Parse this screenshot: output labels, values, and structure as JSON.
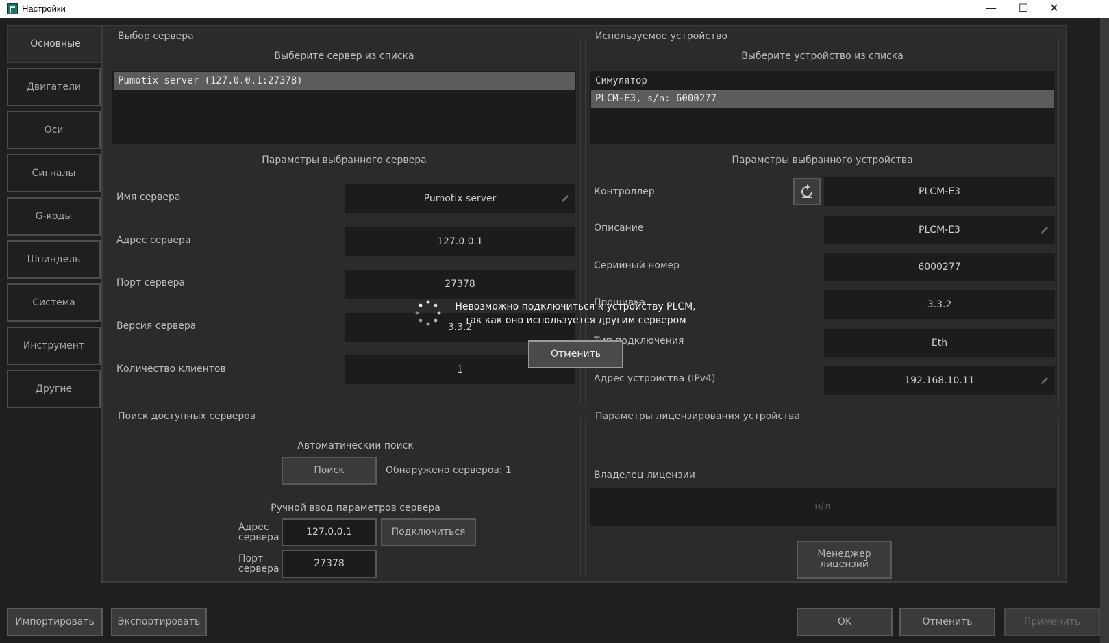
{
  "window": {
    "title": "Настройки",
    "minimize": "—",
    "maximize": "☐",
    "close": "✕"
  },
  "tabs": [
    "Основные",
    "Двигатели",
    "Оси",
    "Сигналы",
    "G-коды",
    "Шпиндель",
    "Система",
    "Инструмент",
    "Другие"
  ],
  "server": {
    "group_title": "Выбор сервера",
    "list_caption": "Выберите сервер из списка",
    "list": [
      "Pumotix server (127.0.0.1:27378)"
    ],
    "params_caption": "Параметры выбранного сервера",
    "name_label": "Имя сервера",
    "name_value": "Pumotix server",
    "address_label": "Адрес сервера",
    "address_value": "127.0.0.1",
    "port_label": "Порт сервера",
    "port_value": "27378",
    "version_label": "Версия сервера",
    "version_value": "3.3.2",
    "clients_label": "Количество клиентов",
    "clients_value": "1"
  },
  "device": {
    "group_title": "Используемое устройство",
    "list_caption": "Выберите устройство из списка",
    "list": [
      "Симулятор",
      "PLCM-E3, s/n: 6000277"
    ],
    "params_caption": "Параметры выбранного устройства",
    "controller_label": "Контроллер",
    "controller_value": "PLCM-E3",
    "description_label": "Описание",
    "description_value": "PLCM-E3",
    "serial_label": "Серийный номер",
    "serial_value": "6000277",
    "firmware_label": "Прошивка",
    "firmware_value": "3.3.2",
    "conn_label": "Тип подключения",
    "conn_value": "Eth",
    "ip_label": "Адрес устройства (IPv4)",
    "ip_value": "192.168.10.11"
  },
  "search": {
    "group_title": "Поиск доступных серверов",
    "auto_caption": "Автоматический поиск",
    "search_button": "Поиск",
    "found_text": "Обнаружено серверов: 1",
    "manual_caption": "Ручной ввод параметров сервера",
    "addr_label_1": "Адрес",
    "addr_label_2": "сервера",
    "addr_value": "127.0.0.1",
    "port_label_1": "Порт",
    "port_label_2": "сервера",
    "port_value": "27378",
    "connect_button": "Подключиться"
  },
  "license": {
    "group_title": "Параметры лицензирования устройства",
    "owner_label": "Владелец лицензии",
    "owner_value": "н/д",
    "manager_button_1": "Менеджер",
    "manager_button_2": "лицензий"
  },
  "overlay": {
    "message_line1": "Невозможно подключиться к устройству PLCM,",
    "message_line2": "так как оно используется другим сервером",
    "cancel_button": "Отменить"
  },
  "footer": {
    "import": "Импортировать",
    "export": "Экспортировать",
    "ok": "OK",
    "cancel": "Отменить",
    "apply": "Применить"
  },
  "colors": {
    "window_bg": "#1f1f1f",
    "panel_bg": "#2b2b2b",
    "field_bg": "#1c1c1c",
    "selected_item": "#5c5c5c"
  }
}
